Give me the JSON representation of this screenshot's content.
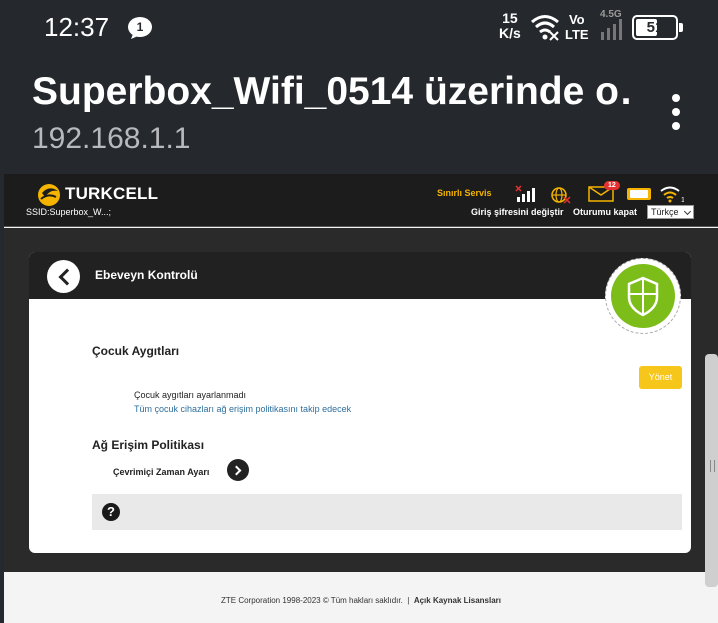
{
  "status_bar": {
    "time": "12:37",
    "notification_count": "1",
    "speed_value": "15",
    "speed_unit": "K/s",
    "volte_top": "Vo",
    "volte_bottom": "LTE",
    "network_type": "4.5G",
    "battery": "51"
  },
  "app_bar": {
    "title": "Superbox_Wifi_0514 üzerinde o…",
    "url": "192.168.1.1"
  },
  "router_header": {
    "brand": "TURKCELL",
    "ssid": "SSID:Superbox_W...;",
    "limited_service": "Sınırlı Servis",
    "mail_count": "12",
    "change_password": "Giriş şifresini değiştir",
    "logout": "Oturumu kapat",
    "language": "Türkçe",
    "colors": {
      "brand_yellow": "#f4b400",
      "badge_red": "#e53030"
    }
  },
  "card": {
    "title": "Ebeveyn Kontrolü",
    "child_devices_title": "Çocuk Aygıtları",
    "child_devices_status": "Çocuk aygıtları ayarlanmadı",
    "child_devices_info": "Tüm çocuk cihazları ağ erişim politikasını takip edecek",
    "manage_button": "Yönet",
    "access_policy_title": "Ağ Erişim Politikası",
    "online_time": "Çevrimiçi Zaman Ayarı",
    "help_symbol": "?",
    "colors": {
      "shield_green": "#7cbd1a",
      "manage_yellow": "#f7c61a"
    }
  },
  "footer": {
    "copyright": "ZTE Corporation 1998-2023 © Tüm hakları saklıdır.",
    "separator": "|",
    "license_link": "Açık Kaynak Lisansları"
  }
}
